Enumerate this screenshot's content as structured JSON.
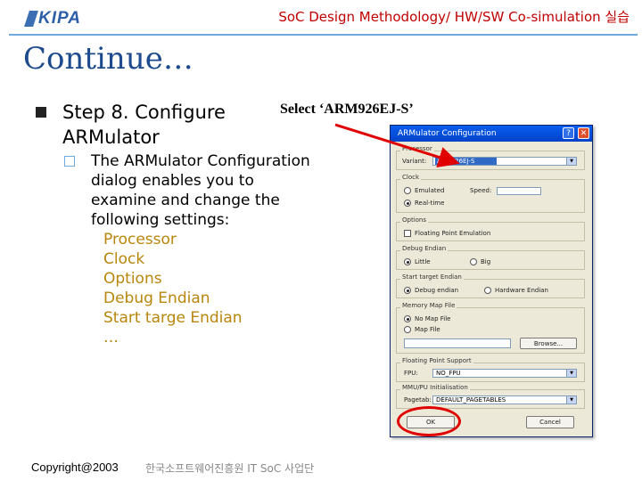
{
  "header": {
    "logo_text": "KIPA",
    "course_title": "SoC Design Methodology/ HW/SW Co-simulation 실습"
  },
  "slide": {
    "title": "Continue…",
    "step_line1": "Step 8. Configure",
    "step_line2": "ARMulator",
    "callout": "Select ‘ARM926EJ-S’",
    "desc_lines": [
      "The ARMulator Configuration",
      "dialog enables you to",
      "examine and change the",
      "following settings:"
    ],
    "settings": [
      "Processor",
      "Clock",
      "Options",
      "Debug Endian",
      "Start targe Endian",
      "…"
    ]
  },
  "footer": {
    "copyright": "Copyright@2003",
    "org": "한국소프트웨어진흥원  IT SoC 사업단"
  },
  "dialog": {
    "title": "ARMulator Configuration",
    "help_glyph": "?",
    "close_glyph": "✕",
    "processor_group": "Processor",
    "variant_label": "Variant:",
    "variant_value": "ARM926EJ-S",
    "clock_group": "Clock",
    "clock_emulated": "Emulated",
    "clock_speed_label": "Speed:",
    "clock_realtime": "Real-time",
    "options_group": "Options",
    "option_float": "Floating Point Emulation",
    "debug_group": "Debug Endian",
    "debug_little": "Little",
    "debug_big": "Big",
    "start_group": "Start target Endian",
    "start_debug": "Debug endian",
    "start_hardware": "Hardware Endian",
    "memmap_group": "Memory Map File",
    "memmap_none": "No Map File",
    "memmap_file": "Map File",
    "browse_label": "Browse...",
    "fpu_group": "Floating Point Support",
    "fpu_label": "FPU:",
    "fpu_value": "NO_FPU",
    "mmu_group": "MMU/PU Initialisation",
    "mmu_label": "Pagetab:",
    "mmu_value": "DEFAULT_PAGETABLES",
    "ok_label": "OK",
    "cancel_label": "Cancel"
  },
  "colors": {
    "course_title": "#c00000",
    "slide_title": "#1d4a8c",
    "settings_text": "#b8860b",
    "highlight": "#e00000"
  }
}
